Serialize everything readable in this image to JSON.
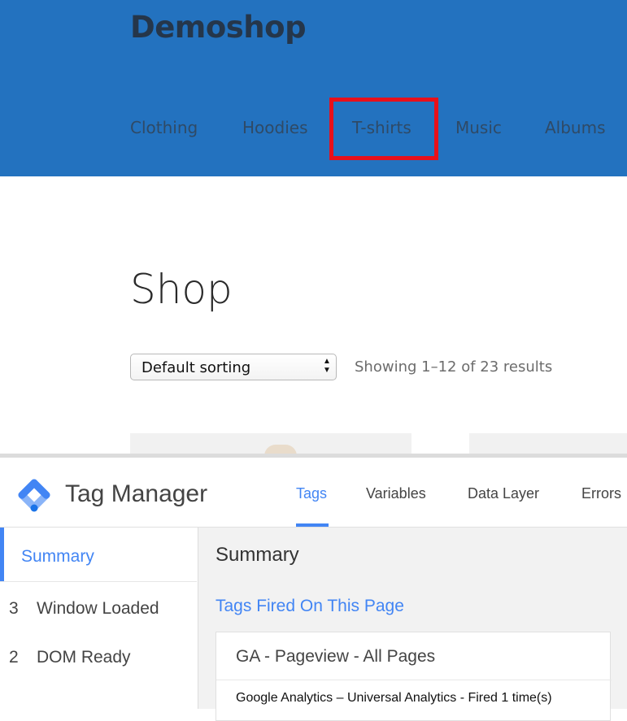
{
  "site": {
    "title": "Demoshop",
    "nav": [
      "Clothing",
      "Hoodies",
      "T-shirts",
      "Music",
      "Albums"
    ],
    "highlighted_nav": "T-shirts",
    "highlight_color": "#e8101a",
    "header_color": "#2372bf"
  },
  "shop": {
    "title": "Shop",
    "sort_selected": "Default sorting",
    "result_count": "Showing 1–12 of 23 results"
  },
  "gtm": {
    "brand": "Tag Manager",
    "tabs": [
      "Tags",
      "Variables",
      "Data Layer",
      "Errors"
    ],
    "active_tab": "Tags",
    "accent_color": "#4285f4",
    "sidebar": {
      "summary": "Summary",
      "items": [
        {
          "num": "3",
          "label": "Window Loaded"
        },
        {
          "num": "2",
          "label": "DOM Ready"
        }
      ]
    },
    "main": {
      "title": "Summary",
      "section": "Tags Fired On This Page",
      "tag": {
        "name": "GA - Pageview - All Pages",
        "detail": "Google Analytics – Universal Analytics - Fired 1 time(s)"
      }
    }
  }
}
